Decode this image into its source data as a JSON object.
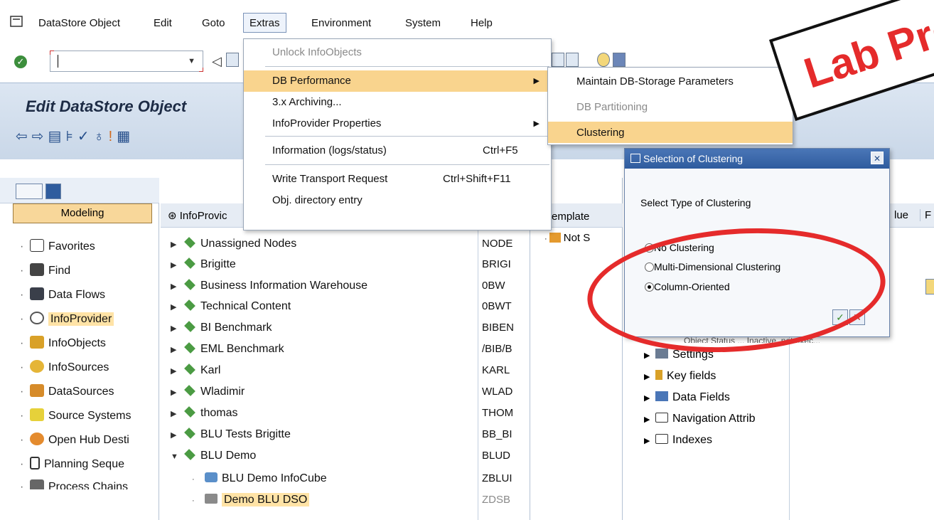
{
  "menubar": {
    "items": [
      "DataStore Object",
      "Edit",
      "Goto",
      "Extras",
      "Environment",
      "System",
      "Help"
    ]
  },
  "header": {
    "title": "Edit DataStore Object"
  },
  "left": {
    "modeling_label": "Modeling",
    "items": [
      "Favorites",
      "Find",
      "Data Flows",
      "InfoProvider",
      "InfoObjects",
      "InfoSources",
      "DataSources",
      "Source Systems",
      "Open Hub Desti",
      "Planning Seque",
      "Process Chains"
    ]
  },
  "tree": {
    "header_label": "InfoProvic",
    "rows": [
      {
        "label": "Unassigned Nodes",
        "code": "NODE"
      },
      {
        "label": "Brigitte",
        "code": "BRIGI"
      },
      {
        "label": "Business Information Warehouse",
        "code": "0BW"
      },
      {
        "label": "Technical Content",
        "code": "0BWT"
      },
      {
        "label": "BI Benchmark",
        "code": "BIBEN"
      },
      {
        "label": "EML Benchmark",
        "code": "/BIB/B"
      },
      {
        "label": "Karl",
        "code": "KARL"
      },
      {
        "label": "Wladimir",
        "code": "WLAD"
      },
      {
        "label": "thomas",
        "code": "THOM"
      },
      {
        "label": "BLU Tests Brigitte",
        "code": "BB_BI"
      },
      {
        "label": "BLU Demo",
        "code": "BLUD"
      },
      {
        "label": "BLU Demo InfoCube",
        "code": "ZBLUI"
      },
      {
        "label": "Demo BLU DSO",
        "code": "ZDSB"
      }
    ]
  },
  "template": {
    "header_label": "emplate",
    "row_label": "Not S"
  },
  "right": {
    "header_cols": [
      "lue",
      "F"
    ],
    "partial_row": "Object Status ... Inactive, not exec...",
    "rows": [
      "Settings",
      "Key fields",
      "Data Fields",
      "Navigation Attrib",
      "Indexes"
    ]
  },
  "extras_menu": {
    "items": [
      {
        "label": "Unlock InfoObjects",
        "shortcut": "",
        "disabled": true,
        "submenu": false
      },
      {
        "label": "DB Performance",
        "shortcut": "",
        "disabled": false,
        "submenu": true
      },
      {
        "label": "3.x Archiving...",
        "shortcut": "",
        "disabled": false,
        "submenu": false
      },
      {
        "label": "InfoProvider Properties",
        "shortcut": "",
        "disabled": false,
        "submenu": true
      },
      {
        "label": "Information (logs/status)",
        "shortcut": "Ctrl+F5",
        "disabled": false,
        "submenu": false
      },
      {
        "label": "Write Transport Request",
        "shortcut": "Ctrl+Shift+F11",
        "disabled": false,
        "submenu": false
      },
      {
        "label": "Obj. directory entry",
        "shortcut": "",
        "disabled": false,
        "submenu": false
      }
    ]
  },
  "db_submenu": {
    "items": [
      "Maintain DB-Storage Parameters",
      "DB Partitioning",
      "Clustering"
    ]
  },
  "dialog": {
    "title": "Selection of Clustering",
    "label": "Select Type of Clustering",
    "options": [
      "No Clustering",
      "Multi-Dimensional Clustering",
      "Column-Oriented"
    ],
    "selected": "Column-Oriented"
  },
  "stamp": {
    "text": "Lab Pro"
  },
  "colors": {
    "menu_highlight": "#f9d48e",
    "annotation_red": "#e52b2b",
    "dialog_title": "#2f5c9e"
  }
}
